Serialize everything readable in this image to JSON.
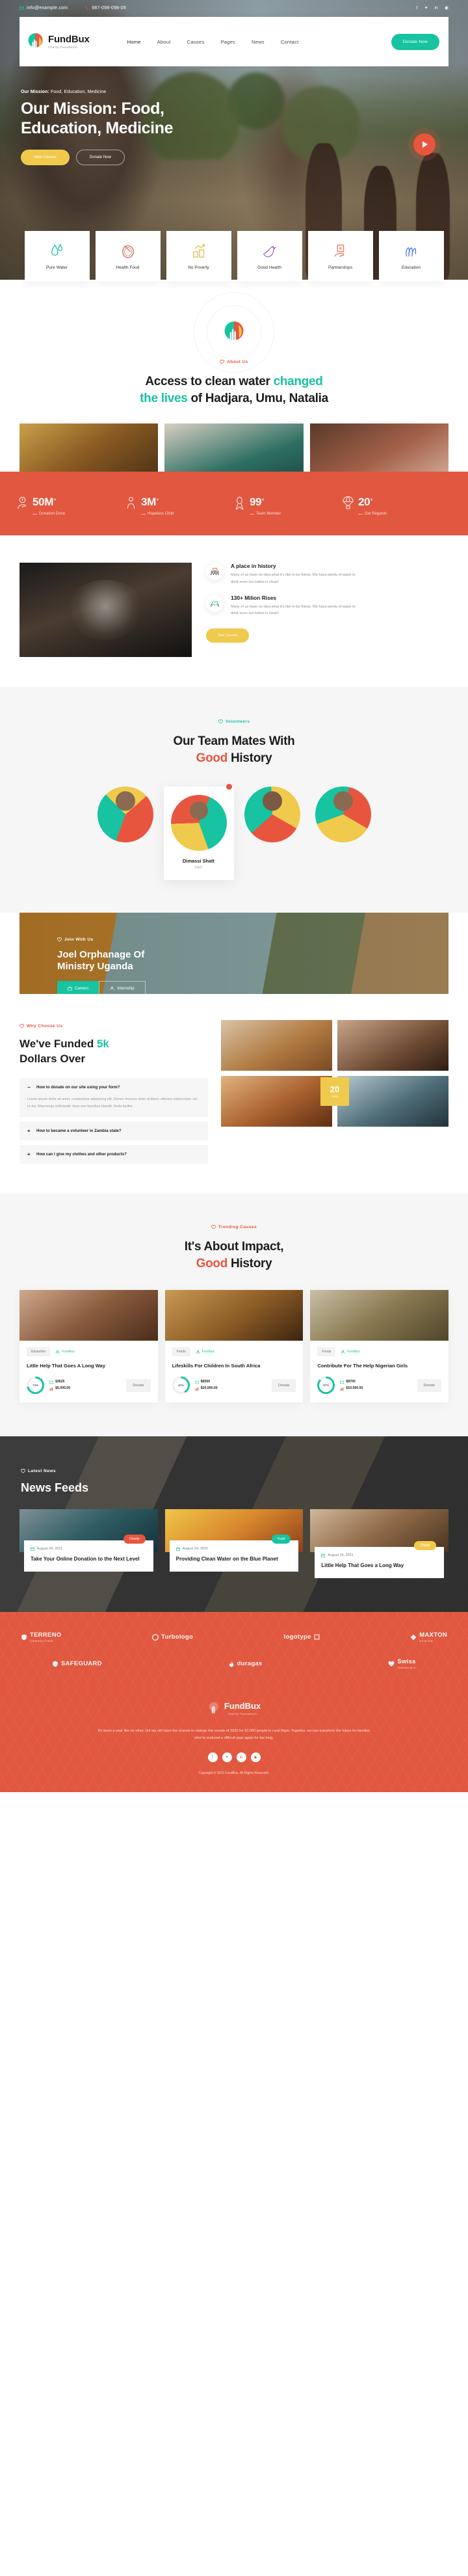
{
  "topbar": {
    "email": "info@example.com",
    "phone": "987-098-098-09",
    "socials": [
      "facebook-icon",
      "twitter-icon",
      "linkedin-icon",
      "dribbble-icon"
    ]
  },
  "brand": {
    "name": "FundBux",
    "tagline": "Charity Foundation"
  },
  "nav": {
    "items": [
      {
        "label": "Home",
        "active": true
      },
      {
        "label": "About",
        "active": false
      },
      {
        "label": "Causes",
        "active": false
      },
      {
        "label": "Pages",
        "active": false
      },
      {
        "label": "News",
        "active": false
      },
      {
        "label": "Contact",
        "active": false
      }
    ],
    "cta": "Donate Now"
  },
  "hero": {
    "eyebrow_strong": "Our Mission:",
    "eyebrow_rest": " Food, Education, Medicine",
    "title_line1": "Our Mission: Food,",
    "title_line2": "Education, Medicine",
    "btn_primary": "View Causes",
    "btn_secondary": "Donate Now",
    "play": "play-icon"
  },
  "services": [
    {
      "label": "Pure Water",
      "icon": "water-drops-icon",
      "color": "#17c3a0"
    },
    {
      "label": "Health Food",
      "icon": "food-plate-icon",
      "color": "#d4625c"
    },
    {
      "label": "No Poverty",
      "icon": "money-growth-icon",
      "color": "#e0b93c"
    },
    {
      "label": "Good Health",
      "icon": "dove-icon",
      "color": "#9b59d0"
    },
    {
      "label": "Partnerships",
      "icon": "donation-hand-icon",
      "color": "#ef6b4a"
    },
    {
      "label": "Education",
      "icon": "hands-book-icon",
      "color": "#3d6ee8"
    }
  ],
  "about": {
    "eyebrow": "About Us",
    "title_1": "Access to clean water ",
    "title_accent_1": "changed",
    "title_accent_2": "the lives",
    "title_2": " of Hadjara, Umu, Natalia"
  },
  "stats": [
    {
      "value": "50M",
      "plus": "+",
      "label": "Donation Done",
      "icon": "donation-box-icon"
    },
    {
      "value": "3M",
      "plus": "+",
      "label": "Hopeless Child",
      "icon": "child-icon"
    },
    {
      "value": "99",
      "plus": "+",
      "label": "Team Member",
      "icon": "ribbon-icon"
    },
    {
      "value": "20",
      "plus": "+",
      "label": "Get Regards",
      "icon": "parachute-icon"
    }
  ],
  "history": {
    "features": [
      {
        "title": "A place in history",
        "text": "Many of us have no idea what it's like to be thirsty. We have plenty of water to drink even our toilets is clean!",
        "icon": "group-heart-icon"
      },
      {
        "title": "130+ Milion Rises",
        "text": "Many of us have no idea what it's like to be thirsty. We have plenty of water to drink even our toilets is clean!",
        "icon": "heart-hands-icon"
      }
    ],
    "button": "See Causes"
  },
  "team": {
    "eyebrow": "Volunteers",
    "title_1": "Our Team Mates With",
    "title_accent": "Good",
    "title_2": " History",
    "members": [
      {
        "name": "",
        "role": "",
        "featured": false
      },
      {
        "name": "Dimassi Shatt",
        "role": "CEO",
        "featured": true
      },
      {
        "name": "",
        "role": "",
        "featured": false
      },
      {
        "name": "",
        "role": "",
        "featured": false
      }
    ]
  },
  "joel": {
    "eyebrow": "Join With Us",
    "title_line1": "Joel Orphanage Of",
    "title_line2": "Ministry Uganda",
    "btn_careers": "Careers",
    "btn_internship": "Internship"
  },
  "funded": {
    "eyebrow": "Why Choose Us",
    "title_1": "We've Funded ",
    "title_accent": "5k",
    "title_2": "Dollars Over",
    "badge_number": "20",
    "badge_label": "Years",
    "faq": [
      {
        "sign": "−",
        "question": "How to donate on our site using your form?",
        "answer": "Lorem ipsum dolor sit amet, consectetur adipiscing elit. Donec rhoncus dolor at libero ultricies ullamcorper vel ut dui. Maecenas sollicitudin risus non faucibus blandit. Nulla facilisi.",
        "open": true
      },
      {
        "sign": "+",
        "question": "How to became a volunteer in Zambia state?",
        "answer": "",
        "open": false
      },
      {
        "sign": "+",
        "question": "How can I give my clothes and other products?",
        "answer": "",
        "open": false
      }
    ]
  },
  "causes": {
    "eyebrow": "Trending Causes",
    "title_1": "It's About Impact,",
    "title_accent": "Good",
    "title_2": " History",
    "items": [
      {
        "tag": "Eduaction",
        "author": "Fundbux",
        "title": "Little Help That Goes A Long Way",
        "percent": "72",
        "percent_suffix": "%",
        "raised": "$3625",
        "goal": "$5,000.00",
        "donate": "Donate"
      },
      {
        "tag": "Foods",
        "author": "Fundbux",
        "title": "Lifeskills For Children In South Africa",
        "percent": "42",
        "percent_suffix": "%",
        "raised": "$8550",
        "goal": "$20,000.00",
        "donate": "Donate"
      },
      {
        "tag": "Foods",
        "author": "Fundbux",
        "title": "Contribute For The Help Nigerian Girls",
        "percent": "87",
        "percent_suffix": "%",
        "raised": "$8700",
        "goal": "$10,000.00",
        "donate": "Donate"
      }
    ]
  },
  "news": {
    "eyebrow": "Latest News",
    "title": "News Feeds",
    "items": [
      {
        "pill": "Charity",
        "pill_color": "#e8553e",
        "date": "August 24, 2021",
        "title": "Take Your Online Donation to the Next Level"
      },
      {
        "pill": "Food",
        "pill_color": "#17c3a0",
        "date": "August 24, 2021",
        "title": "Providing Clean Water on the Blue Planet"
      },
      {
        "pill": "Charity",
        "pill_color": "#f0ca4d",
        "date": "August 24, 2021",
        "title": "Little Help That Goes a Long Way"
      }
    ]
  },
  "brands": {
    "row1": [
      {
        "name": "TERRENO",
        "sub": "CONSULTING"
      },
      {
        "name": "Turbologo",
        "sub": ""
      },
      {
        "name": "logotype",
        "sub": ""
      },
      {
        "name": "MAXTON",
        "sub": "DESIGN"
      }
    ],
    "row2": [
      {
        "name": "SAFEGUARD",
        "sub": ""
      },
      {
        "name": "duragas",
        "sub": ""
      },
      {
        "name": "Swiss",
        "sub": "healthcare"
      }
    ]
  },
  "footer": {
    "brand": "FundBux",
    "tagline": "Charity Foundation",
    "text": "It's been a year like no other, but we still have the chance to change the course of 2020 for 10,000 people in rural Niger. Together, we can transform the future for families who've endured a difficult year again for too long.",
    "socials": [
      "f",
      "t",
      "in",
      "d"
    ],
    "copyright": "Copyright © 2021 FundBux. All Rights Reserved."
  }
}
